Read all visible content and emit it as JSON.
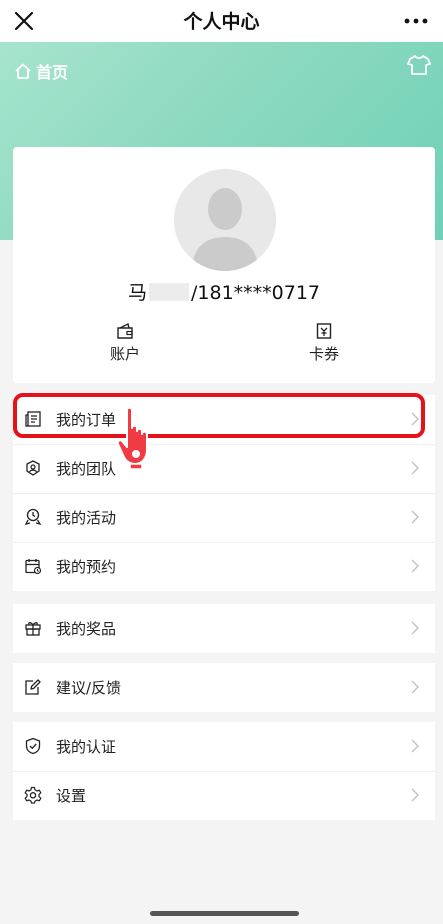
{
  "topbar": {
    "title": "个人中心"
  },
  "hero": {
    "home_label": "首页"
  },
  "profile": {
    "name_prefix": "马",
    "name_suffix": "/181****0717",
    "quick_links": [
      {
        "label": "账户",
        "icon": "wallet-icon"
      },
      {
        "label": "卡券",
        "icon": "coupon-icon"
      }
    ]
  },
  "menu": {
    "orders": "我的订单",
    "team": "我的团队",
    "activity": "我的活动",
    "booking": "我的预约",
    "prizes": "我的奖品",
    "feedback": "建议/反馈",
    "certification": "我的认证",
    "settings": "设置"
  },
  "colors": {
    "hero_gradient": [
      "#a7e4ce",
      "#6fd0b8"
    ],
    "highlight": "#e3121b",
    "hand": "#f03b44"
  }
}
